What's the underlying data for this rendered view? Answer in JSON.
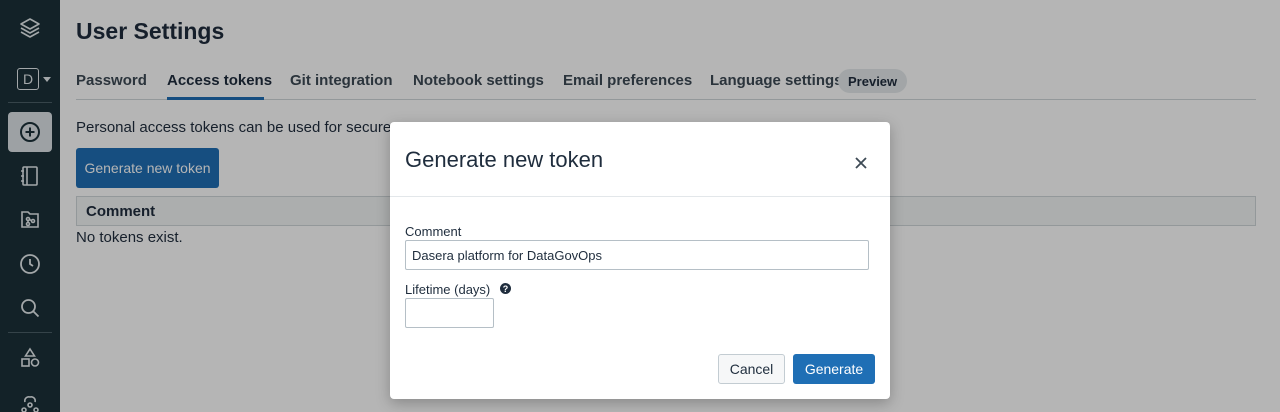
{
  "sidebar": {
    "workspace_initial": "D",
    "icons": [
      "layers-icon",
      "workspace-switcher",
      "plus-circle-icon",
      "notebook-icon",
      "repos-icon",
      "clock-icon",
      "search-icon",
      "shapes-icon",
      "compute-icon"
    ]
  },
  "page": {
    "title": "User Settings",
    "tabs": [
      {
        "label": "Password",
        "active": false
      },
      {
        "label": "Access tokens",
        "active": true
      },
      {
        "label": "Git integration",
        "active": false
      },
      {
        "label": "Notebook settings",
        "active": false
      },
      {
        "label": "Email preferences",
        "active": false
      },
      {
        "label": "Language settings",
        "active": false
      }
    ],
    "preview_badge": "Preview",
    "description": "Personal access tokens can be used for secure a",
    "generate_button": "Generate new token",
    "table": {
      "columns": [
        "Comment"
      ]
    },
    "empty_message": "No tokens exist."
  },
  "modal": {
    "title": "Generate new token",
    "comment_label": "Comment",
    "comment_value": "Dasera platform for DataGovOps",
    "lifetime_label": "Lifetime (days)",
    "lifetime_value": "",
    "help_glyph": "?",
    "cancel_label": "Cancel",
    "generate_label": "Generate"
  },
  "colors": {
    "sidebar_bg": "#1b3139",
    "primary": "#1f6fb5",
    "overlay": "rgba(0,0,0,0.29)"
  }
}
